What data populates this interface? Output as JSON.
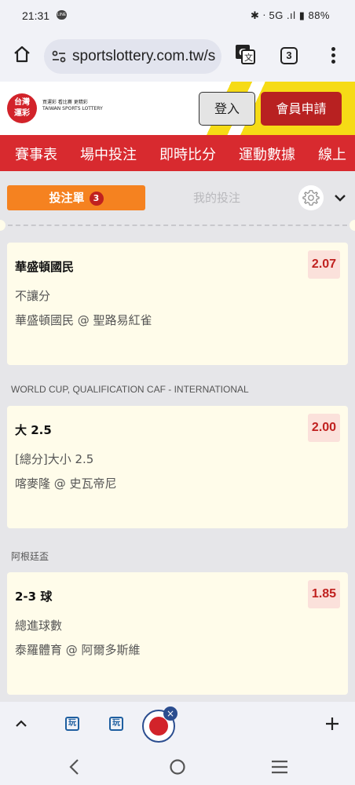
{
  "status_bar": {
    "time": "21:31",
    "app_badge": "LINE",
    "indicators": "✱ ᐧ 5G .ıl",
    "battery": "88%"
  },
  "browser": {
    "url": "sportslottery.com.tw/s",
    "tab_count": "3"
  },
  "site": {
    "logo_text": "台灣\n運彩",
    "tagline": "買運彩 看比賽 更精彩",
    "tagline_en": "TAIWAN SPORTS LOTTERY",
    "login_label": "登入",
    "signup_label": "會員申請"
  },
  "nav": {
    "items": [
      "賽事表",
      "場中投注",
      "即時比分",
      "運動數據",
      "線上"
    ]
  },
  "betslip": {
    "active_tab": "投注單",
    "active_count": "3",
    "inactive_tab": "我的投注",
    "bets": [
      {
        "league": "",
        "selection": "華盛頓國民",
        "market": "不讓分",
        "match": "華盛頓國民 @ 聖路易紅雀",
        "odds": "2.07"
      },
      {
        "league": "WORLD CUP, QUALIFICATION CAF - INTERNATIONAL",
        "selection": "大 2.5",
        "market": "[總分]大小 2.5",
        "match": "喀麥隆 @ 史瓦帝尼",
        "odds": "2.00"
      },
      {
        "league": "阿根廷盃",
        "selection": "2-3 球",
        "market": "總進球數",
        "match": "泰羅體育 @ 阿爾多斯維",
        "odds": "1.85"
      }
    ]
  },
  "colors": {
    "brand_red": "#d82a2f",
    "signup_red": "#b82121",
    "tab_orange": "#f58220",
    "odds_red": "#c0211f",
    "card_bg": "#fffcea"
  }
}
